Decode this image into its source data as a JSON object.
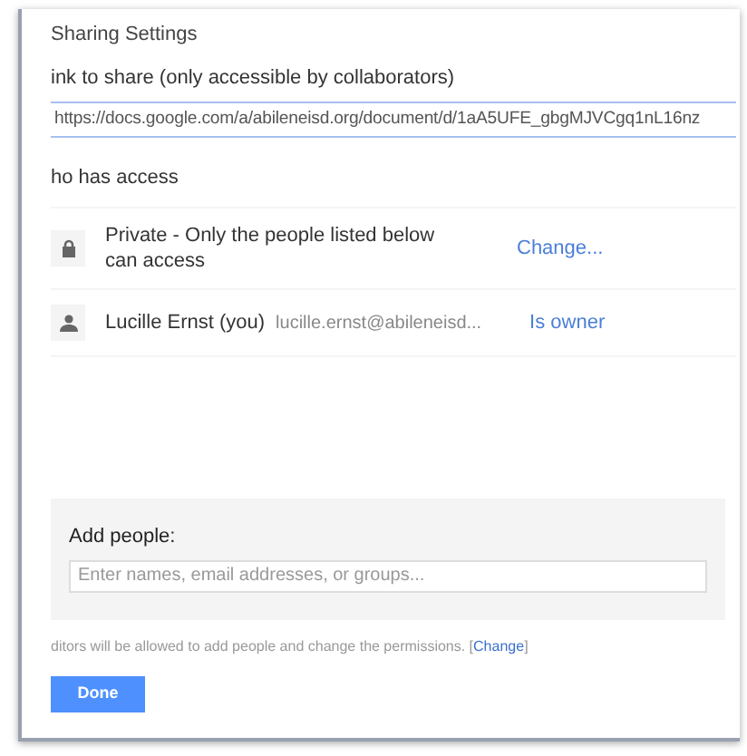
{
  "dialog": {
    "title": "Sharing Settings"
  },
  "link": {
    "label": "ink to share (only accessible by collaborators)",
    "value": "https://docs.google.com/a/abileneisd.org/document/d/1aA5UFE_gbgMJVCgq1nL16nz"
  },
  "access": {
    "heading": "ho has access",
    "rows": [
      {
        "kind": "visibility",
        "text": "Private - Only the people listed below can access",
        "action": "Change..."
      },
      {
        "kind": "person",
        "name": "Lucille Ernst (you)",
        "email": "lucille.ernst@abileneisd...",
        "action": "Is owner"
      }
    ]
  },
  "add_people": {
    "label": "Add people:",
    "placeholder": "Enter names, email addresses, or groups..."
  },
  "note": {
    "text": "ditors will be allowed to add people and change the permissions. [",
    "link": "Change",
    "end": "]"
  },
  "done_button": "Done"
}
